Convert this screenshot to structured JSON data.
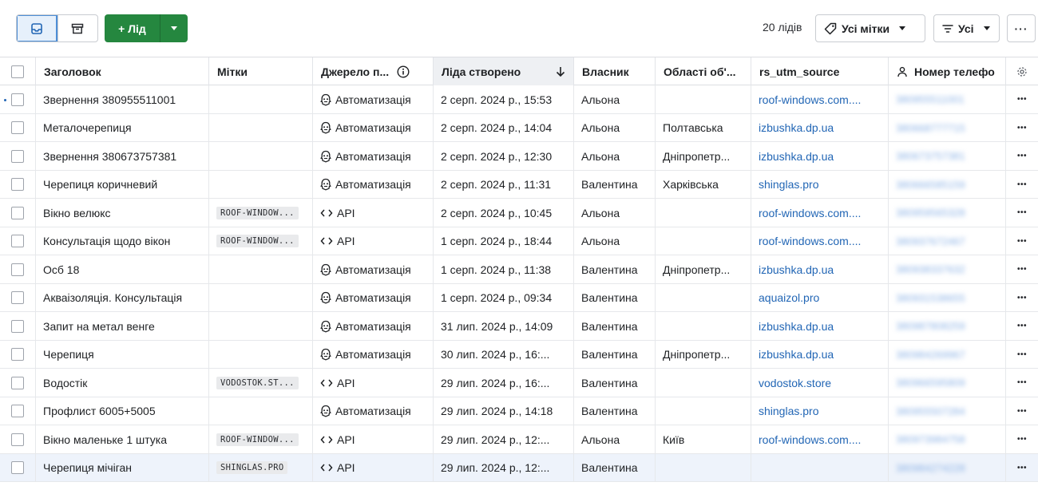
{
  "toolbar": {
    "add_label": "+ Лід",
    "lead_count": "20 лідів",
    "tags_filter_label": "Усі мітки",
    "filter_label": "Усі",
    "more_label": "···"
  },
  "columns": {
    "title": "Заголовок",
    "tags": "Мітки",
    "source": "Джерело п...",
    "created": "Ліда створено",
    "owner": "Власник",
    "region": "Області об'...",
    "utm": "rs_utm_source",
    "phone": "Номер телефо"
  },
  "rows": [
    {
      "title": "Звернення 380955511001",
      "tag": "",
      "source": "Автоматизація",
      "source_kind": "automation",
      "created": "2 серп. 2024 р., 15:53",
      "owner": "Альона",
      "region": "",
      "utm": "roof-windows.com....",
      "phone": "380955511001"
    },
    {
      "title": "Металочерепиця",
      "tag": "",
      "source": "Автоматизація",
      "source_kind": "automation",
      "created": "2 серп. 2024 р., 14:04",
      "owner": "Альона",
      "region": "Полтавська",
      "utm": "izbushka.dp.ua",
      "phone": "380668777715"
    },
    {
      "title": "Звернення 380673757381",
      "tag": "",
      "source": "Автоматизація",
      "source_kind": "automation",
      "created": "2 серп. 2024 р., 12:30",
      "owner": "Альона",
      "region": "Дніпропетр...",
      "utm": "izbushka.dp.ua",
      "phone": "380673757381"
    },
    {
      "title": "Черепиця коричневий",
      "tag": "",
      "source": "Автоматизація",
      "source_kind": "automation",
      "created": "2 серп. 2024 р., 11:31",
      "owner": "Валентина",
      "region": "Харківська",
      "utm": "shinglas.pro",
      "phone": "380666585159"
    },
    {
      "title": "Вікно велюкс",
      "tag": "ROOF-WINDOW...",
      "source": "API",
      "source_kind": "api",
      "created": "2 серп. 2024 р., 10:45",
      "owner": "Альона",
      "region": "",
      "utm": "roof-windows.com....",
      "phone": "380959565328"
    },
    {
      "title": "Консультація щодо вікон",
      "tag": "ROOF-WINDOW...",
      "source": "API",
      "source_kind": "api",
      "created": "1 серп. 2024 р., 18:44",
      "owner": "Альона",
      "region": "",
      "utm": "roof-windows.com....",
      "phone": "380937672467"
    },
    {
      "title": "Осб 18",
      "tag": "",
      "source": "Автоматизація",
      "source_kind": "automation",
      "created": "1 серп. 2024 р., 11:38",
      "owner": "Валентина",
      "region": "Дніпропетр...",
      "utm": "izbushka.dp.ua",
      "phone": "380938337632"
    },
    {
      "title": "Акваізоляція. Консультація",
      "tag": "",
      "source": "Автоматизація",
      "source_kind": "automation",
      "created": "1 серп. 2024 р., 09:34",
      "owner": "Валентина",
      "region": "",
      "utm": "aquaizol.pro",
      "phone": "380931538655"
    },
    {
      "title": "Запит на метал венге",
      "tag": "",
      "source": "Автоматизація",
      "source_kind": "automation",
      "created": "31 лип. 2024 р., 14:09",
      "owner": "Валентина",
      "region": "",
      "utm": "izbushka.dp.ua",
      "phone": "380987808259"
    },
    {
      "title": "Черепиця",
      "tag": "",
      "source": "Автоматизація",
      "source_kind": "automation",
      "created": "30 лип. 2024 р., 16:...",
      "owner": "Валентина",
      "region": "Дніпропетр...",
      "utm": "izbushka.dp.ua",
      "phone": "380984269967"
    },
    {
      "title": "Водостік",
      "tag": "VODOSTOK.ST...",
      "source": "API",
      "source_kind": "api",
      "created": "29 лип. 2024 р., 16:...",
      "owner": "Валентина",
      "region": "",
      "utm": "vodostok.store",
      "phone": "380966595809"
    },
    {
      "title": "Профлист 6005+5005",
      "tag": "",
      "source": "Автоматизація",
      "source_kind": "automation",
      "created": "29 лип. 2024 р., 14:18",
      "owner": "Валентина",
      "region": "",
      "utm": "shinglas.pro",
      "phone": "380955507284"
    },
    {
      "title": "Вікно маленьке 1 штука",
      "tag": "ROOF-WINDOW...",
      "source": "API",
      "source_kind": "api",
      "created": "29 лип. 2024 р., 12:...",
      "owner": "Альона",
      "region": "Київ",
      "utm": "roof-windows.com....",
      "phone": "380973984758"
    },
    {
      "title": "Черепиця мічіган",
      "tag": "SHINGLAS.PRO",
      "source": "API",
      "source_kind": "api",
      "created": "29 лип. 2024 р., 12:...",
      "owner": "Валентина",
      "region": "",
      "utm": "",
      "phone": "380984274228"
    }
  ],
  "colors": {
    "primary_green": "#25873f",
    "link_blue": "#2266b5",
    "active_blue": "#4d8ed6"
  }
}
